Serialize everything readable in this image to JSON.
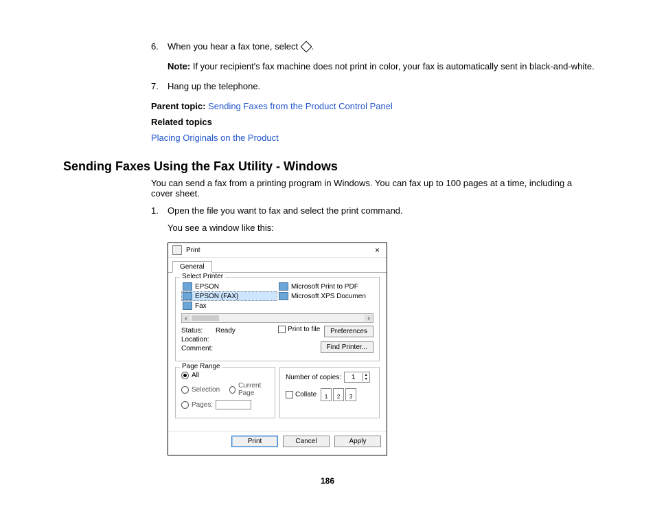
{
  "step6": {
    "num": "6.",
    "text_a": "When you hear a fax tone, select ",
    "text_b": ".",
    "note_label": "Note:",
    "note_text": " If your recipient's fax machine does not print in color, your fax is automatically sent in black-and-white."
  },
  "step7": {
    "num": "7.",
    "text": "Hang up the telephone."
  },
  "parent": {
    "label": "Parent topic: ",
    "link": "Sending Faxes from the Product Control Panel"
  },
  "related": {
    "label": "Related topics",
    "link": "Placing Originals on the Product"
  },
  "section_title": "Sending Faxes Using the Fax Utility - Windows",
  "intro": "You can send a fax from a printing program in Windows. You can fax up to 100 pages at a time, including a cover sheet.",
  "step1": {
    "num": "1.",
    "text": "Open the file you want to fax and select the print command.",
    "sub": "You see a window like this:"
  },
  "dlg": {
    "title": "Print",
    "close": "×",
    "tab": "General",
    "select_printer": "Select Printer",
    "printers_left": [
      "EPSON",
      "EPSON (FAX)",
      "Fax"
    ],
    "printers_right": [
      "Microsoft Print to PDF",
      "Microsoft XPS Documen"
    ],
    "status_label": "Status:",
    "status_value": "Ready",
    "location_label": "Location:",
    "comment_label": "Comment:",
    "print_to_file": "Print to file",
    "preferences": "Preferences",
    "find_printer": "Find Printer...",
    "page_range": "Page Range",
    "all": "All",
    "selection": "Selection",
    "current_page": "Current Page",
    "pages": "Pages:",
    "num_copies": "Number of copies:",
    "copies_val": "1",
    "collate": "Collate",
    "c1": "1",
    "c2": "2",
    "c3": "3",
    "btn_print": "Print",
    "btn_cancel": "Cancel",
    "btn_apply": "Apply"
  },
  "page_number": "186"
}
